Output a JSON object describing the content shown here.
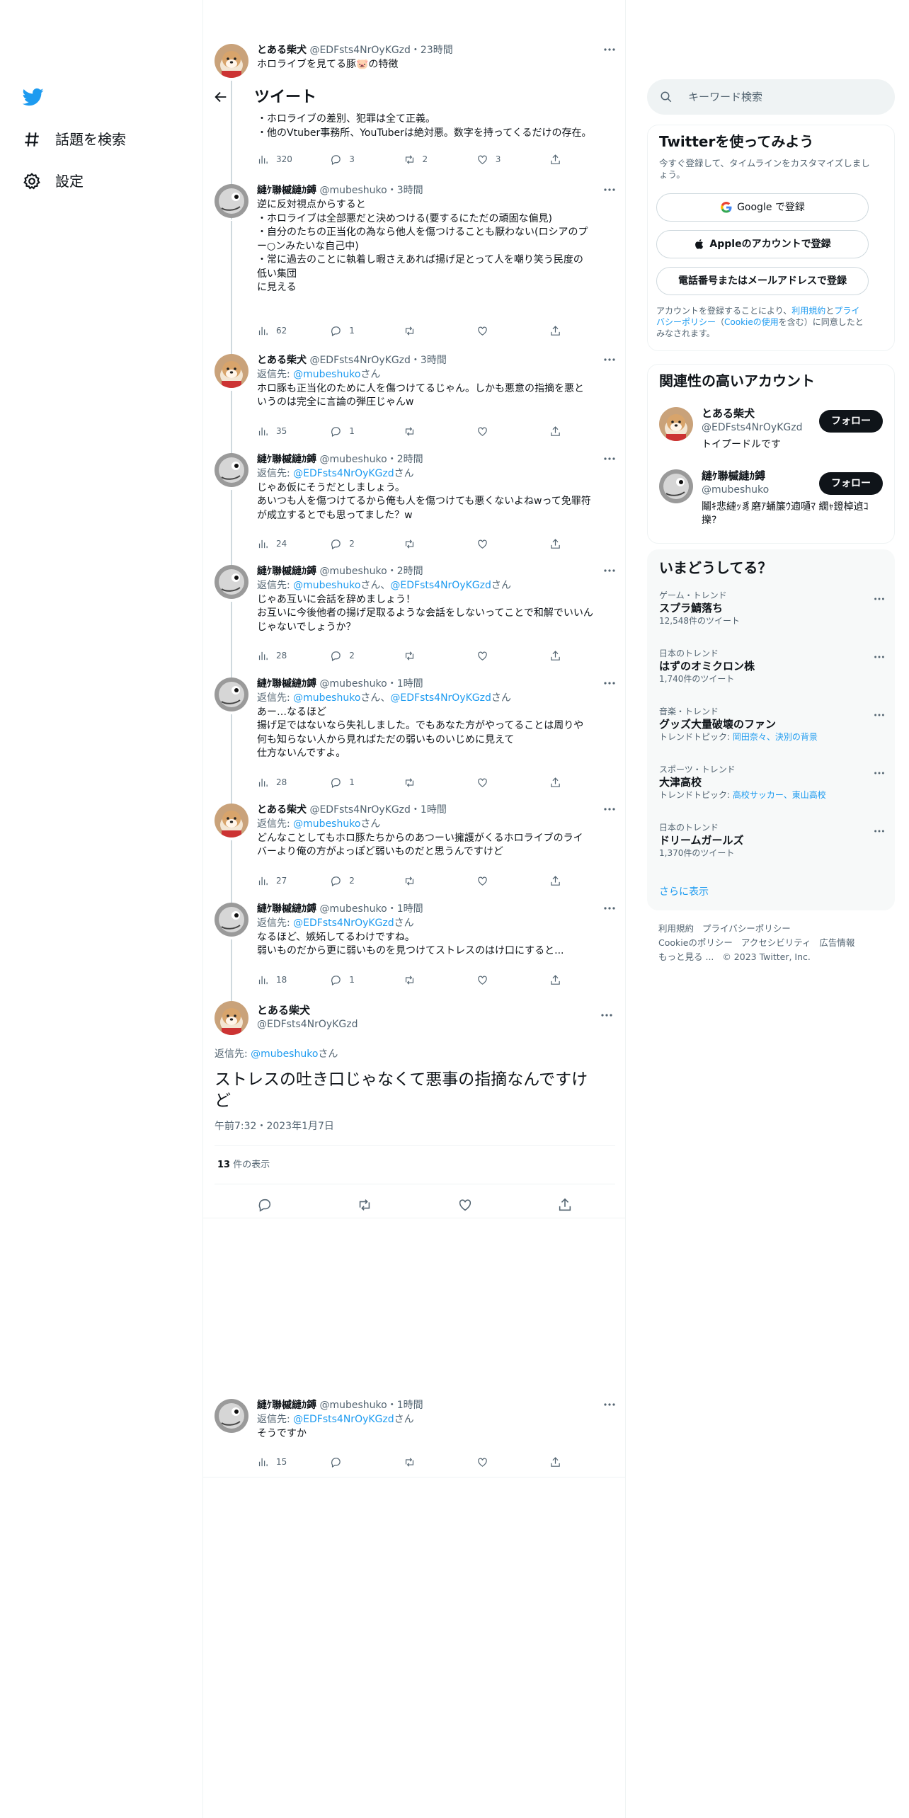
{
  "nav": {
    "explore": "話題を検索",
    "settings": "設定"
  },
  "header": {
    "title": "ツイート"
  },
  "thread": [
    {
      "name": "とある柴犬",
      "handle": "@EDFsts4NrOyKGzd",
      "time": "23時間",
      "lines": [
        "ホロライブを見てる豚🐷の特徴",
        "",
        "・ホロライブの差別、犯罪は全て正義。",
        "・他のVtuber事務所、YouTuberは絶対悪。数字を持ってくるだけの存在。"
      ],
      "stats": {
        "views": "320",
        "replies": "3",
        "retweets": "2",
        "likes": "3"
      }
    },
    {
      "name": "縺ｹ聯槭縺ｶ鎛",
      "handle": "@mubeshuko",
      "time": "3時間",
      "reply_prefix": "",
      "reply_to": "",
      "reply_suffix": "",
      "lines": [
        "逆に反対視点からすると",
        "・ホロライブは全部悪だと決めつける(要するにただの頑固な偏見)",
        "・自分のたちの正当化の為なら他人を傷つけることも厭わない(ロシアのプ",
        "ー○ンみたいな自己中)",
        "・常に過去のことに執着し暇さえあれば揚げ足とって人を嘲り笑う民度の",
        "低い集団",
        "に見える"
      ],
      "stats": {
        "views": "62",
        "replies": "1",
        "retweets": "",
        "likes": ""
      }
    },
    {
      "name": "とある柴犬",
      "handle": "@EDFsts4NrOyKGzd",
      "time": "3時間",
      "reply_prefix": "返信先: ",
      "reply_to": "@mubeshuko",
      "reply_suffix": "さん",
      "lines": [
        "ホロ豚も正当化のために人を傷つけてるじゃん。しかも悪意の指摘を悪と",
        "いうのは完全に言論の弾圧じゃんw"
      ],
      "stats": {
        "views": "35",
        "replies": "1",
        "retweets": "",
        "likes": ""
      }
    },
    {
      "name": "縺ｹ聯槭縺ｶ鎛",
      "handle": "@mubeshuko",
      "time": "2時間",
      "reply_prefix": "返信先: ",
      "reply_to": "@EDFsts4NrOyKGzd",
      "reply_suffix": "さん",
      "lines": [
        "じゃあ仮にそうだとしましょう。",
        "あいつも人を傷つけてるから俺も人を傷つけても悪くないよねwって免罪符",
        "が成立するとでも思ってました？w"
      ],
      "stats": {
        "views": "24",
        "replies": "2",
        "retweets": "",
        "likes": ""
      }
    },
    {
      "name": "縺ｹ聯槭縺ｶ鎛",
      "handle": "@mubeshuko",
      "time": "2時間",
      "reply_prefix": "返信先: ",
      "reply_to": "@mubeshuko",
      "reply_mid": "さん、",
      "reply_to2": "@EDFsts4NrOyKGzd",
      "reply_suffix": "さん",
      "lines": [
        "じゃあ互いに会話を辞めましょう！",
        "お互いに今後他者の揚げ足取るような会話をしないってことで和解でいいん",
        "じゃないでしょうか？"
      ],
      "stats": {
        "views": "28",
        "replies": "2",
        "retweets": "",
        "likes": ""
      }
    },
    {
      "name": "縺ｹ聯槭縺ｶ鎛",
      "handle": "@mubeshuko",
      "time": "1時間",
      "reply_prefix": "返信先: ",
      "reply_to": "@mubeshuko",
      "reply_mid": "さん、",
      "reply_to2": "@EDFsts4NrOyKGzd",
      "reply_suffix": "さん",
      "lines": [
        "あー…なるほど",
        "揚げ足ではないなら失礼しました。でもあなた方がやってることは周りや",
        "何も知らない人から見ればただの弱いものいじめに見えて",
        "仕方ないんですよ。"
      ],
      "stats": {
        "views": "28",
        "replies": "1",
        "retweets": "",
        "likes": ""
      }
    },
    {
      "name": "とある柴犬",
      "handle": "@EDFsts4NrOyKGzd",
      "time": "1時間",
      "reply_prefix": "返信先: ",
      "reply_to": "@mubeshuko",
      "reply_suffix": "さん",
      "lines": [
        "どんなことしてもホロ豚たちからのあつーい擁護がくるホロライブのライ",
        "バーより俺の方がよっぽど弱いものだと思うんですけど"
      ],
      "stats": {
        "views": "27",
        "replies": "2",
        "retweets": "",
        "likes": ""
      }
    },
    {
      "name": "縺ｹ聯槭縺ｶ鎛",
      "handle": "@mubeshuko",
      "time": "1時間",
      "reply_prefix": "返信先: ",
      "reply_to": "@EDFsts4NrOyKGzd",
      "reply_suffix": "さん",
      "lines": [
        "なるほど、嫉妬してるわけですね。",
        "弱いものだから更に弱いものを見つけてストレスのはけ口にすると..."
      ],
      "stats": {
        "views": "18",
        "replies": "1",
        "retweets": "",
        "likes": ""
      }
    }
  ],
  "focus": {
    "name": "とある柴犬",
    "handle": "@EDFsts4NrOyKGzd",
    "reply_prefix": "返信先: ",
    "reply_to": "@mubeshuko",
    "reply_suffix": "さん",
    "text_line1": "ストレスの吐き口じゃなくて悪事の指摘なんですけ",
    "text_line2": "ど",
    "timestamp": "午前7:32・2023年1月7日",
    "views_count": "13",
    "views_label": " 件の表示"
  },
  "last_reply": {
    "name": "縺ｹ聯槭縺ｶ鎛",
    "handle": "@mubeshuko",
    "time": "1時間",
    "reply_prefix": "返信先: ",
    "reply_to": "@EDFsts4NrOyKGzd",
    "reply_suffix": "さん",
    "lines": [
      "そうですか"
    ],
    "stats": {
      "views": "15",
      "replies": "",
      "retweets": "",
      "likes": ""
    }
  },
  "search": {
    "placeholder": "キーワード検索"
  },
  "signup": {
    "title": "Twitterを使ってみよう",
    "subtitle_line1": "今すぐ登録して、タイムラインをカスタマイズしまし",
    "subtitle_line2": "ょう。",
    "google": "Google で登録",
    "apple": "Appleのアカウントで登録",
    "phone": "電話番号またはメールアドレスで登録",
    "terms_1": "アカウントを登録することにより、",
    "terms_link1": "利用規約",
    "terms_2": "と",
    "terms_link2a": "プライ",
    "terms_link2b": "バシーポリシー",
    "terms_3": "（",
    "terms_link3": "Cookieの使用",
    "terms_4": "を含む）に同意したと",
    "terms_5": "みなされます。"
  },
  "relevant": {
    "title": "関連性の高いアカウント",
    "accounts": [
      {
        "name": "とある柴犬",
        "handle": "@EDFsts4NrOyKGzd",
        "bio": "トイプードルです",
        "follow": "フォロー"
      },
      {
        "name": "縺ｹ聯槭縺ｶ鎛",
        "handle": "@mubeshuko",
        "bio_line1": "鬮ｷ悲縺ｯ豸磨ｱ蛹簾ｳ遖嗵ﾏ 繝ｬ鐙棹遉ｺ",
        "bio_line2": "擽?",
        "follow": "フォロー"
      }
    ]
  },
  "trends": {
    "title": "いまどうしてる？",
    "items": [
      {
        "cat": "ゲーム・トレンド",
        "name": "スプラ鯖落ち",
        "cnt": "12,548件のツイート"
      },
      {
        "cat": "日本のトレンド",
        "name": "はずのオミクロン株",
        "cnt": "1,740件のツイート"
      },
      {
        "cat": "音楽・トレンド",
        "name": "グッズ大量破壊のファン",
        "topic_prefix": "トレンドトピック: ",
        "topic": "岡田奈々、決別の背景"
      },
      {
        "cat": "スポーツ・トレンド",
        "name": "大津高校",
        "topic_prefix": "トレンドトピック: ",
        "topic": "高校サッカー、東山高校"
      },
      {
        "cat": "日本のトレンド",
        "name": "ドリームガールズ",
        "cnt": "1,370件のツイート"
      }
    ],
    "more": "さらに表示"
  },
  "footer": {
    "l1a": "利用規約",
    "l1b": "プライバシーポリシー",
    "l2a": "Cookieのポリシー",
    "l2b": "アクセシビリティ",
    "l2c": "広告情報",
    "l3a": "もっと見る ...",
    "l3b": "© 2023 Twitter, Inc."
  },
  "colors": {
    "accent": "#1d9bf0",
    "text": "#0f1419",
    "secondary": "#536471",
    "border": "#eff3f4"
  }
}
